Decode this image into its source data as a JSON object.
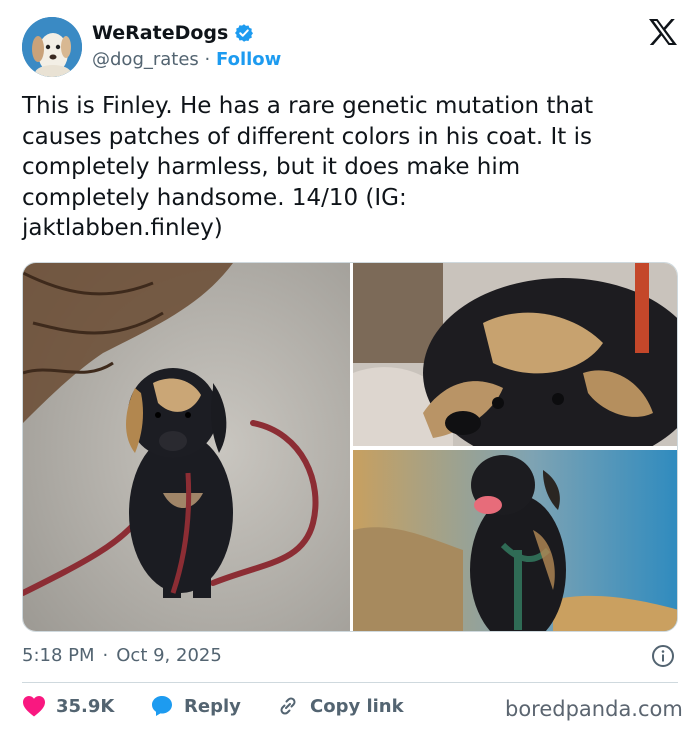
{
  "user": {
    "display_name": "WeRateDogs",
    "handle": "@dog_rates",
    "separator": "·",
    "follow_label": "Follow"
  },
  "tweet": {
    "text": "This is Finley. He has a rare genetic mutation that\ncauses patches of different colors in his coat. It is\ncompletely harmless, but it does make him\ncompletely handsome. 14/10 (IG:\njaktlabben.finley)",
    "time": "5:18 PM",
    "dot": "·",
    "date": "Oct 9, 2025"
  },
  "actions": {
    "like_count": "35.9K",
    "reply_label": "Reply",
    "copy_label": "Copy link"
  },
  "watermark": "boredpanda.com",
  "colors": {
    "accent": "#1d9bf0",
    "like": "#f91880",
    "text": "#0f1419",
    "muted": "#536471",
    "border": "#cfd9de"
  },
  "icons": [
    "verified-badge-icon",
    "x-logo-icon",
    "info-icon",
    "heart-icon",
    "reply-bubble-icon",
    "link-icon"
  ]
}
